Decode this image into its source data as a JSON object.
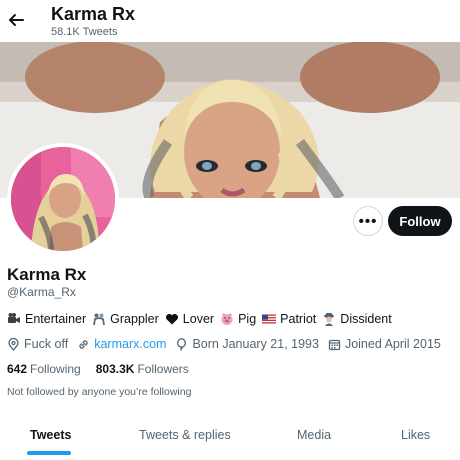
{
  "header": {
    "title": "Karma Rx",
    "tweet_count": "58.1K Tweets"
  },
  "profile": {
    "name": "Karma Rx",
    "handle": "@Karma_Rx",
    "bio": [
      {
        "icon": "video-camera-icon",
        "text": "Entertainer"
      },
      {
        "icon": "wrestler-icon",
        "text": "Grappler"
      },
      {
        "icon": "black-heart-icon",
        "text": "Lover"
      },
      {
        "icon": "pig-face-icon",
        "text": "Pig"
      },
      {
        "icon": "us-flag-icon",
        "text": "Patriot"
      },
      {
        "icon": "detective-icon",
        "text": "Dissident"
      }
    ],
    "location": "Fuck off",
    "website": "karmarx.com",
    "birthday": "Born January 21, 1993",
    "joined": "Joined April 2015",
    "following_count": "642",
    "following_label": "Following",
    "followers_count": "803.3K",
    "followers_label": "Followers",
    "follow_status": "Not followed by anyone you’re following"
  },
  "actions": {
    "more": "•••",
    "follow": "Follow"
  },
  "tabs": [
    {
      "label": "Tweets",
      "active": true
    },
    {
      "label": "Tweets & replies",
      "active": false
    },
    {
      "label": "Media",
      "active": false
    },
    {
      "label": "Likes",
      "active": false
    }
  ],
  "colors": {
    "accent": "#1d9bf0",
    "text": "#0f1419",
    "secondary": "#536471",
    "button": "#0f1419"
  }
}
